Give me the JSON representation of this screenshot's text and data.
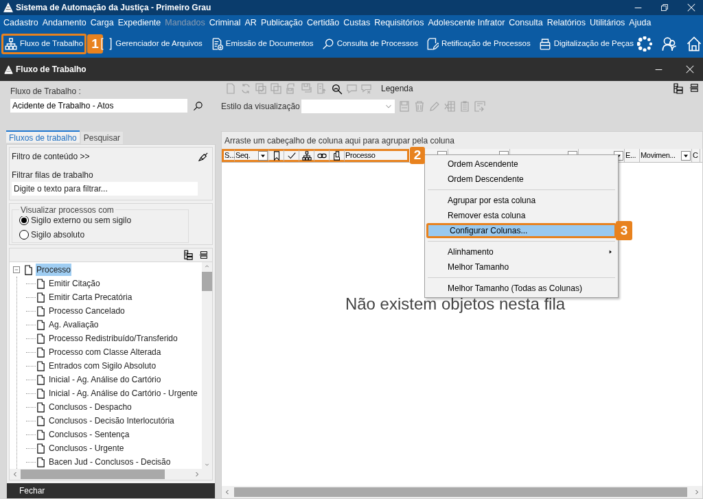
{
  "window": {
    "title": "Sistema de Automação da Justiça - Primeiro Grau"
  },
  "menu": [
    {
      "label": "Cadastro",
      "disabled": false
    },
    {
      "label": "Andamento",
      "disabled": false
    },
    {
      "label": "Carga",
      "disabled": false
    },
    {
      "label": "Expediente",
      "disabled": false
    },
    {
      "label": "Mandados",
      "disabled": true
    },
    {
      "label": "Criminal",
      "disabled": false
    },
    {
      "label": "AR",
      "disabled": false
    },
    {
      "label": "Publicação",
      "disabled": false
    },
    {
      "label": "Certidão",
      "disabled": false
    },
    {
      "label": "Custas",
      "disabled": false
    },
    {
      "label": "Requisitórios",
      "disabled": false
    },
    {
      "label": "Adolescente Infrator",
      "disabled": false
    },
    {
      "label": "Consulta",
      "disabled": false
    },
    {
      "label": "Relatórios",
      "disabled": false
    },
    {
      "label": "Utilitários",
      "disabled": false
    },
    {
      "label": "Ajuda",
      "disabled": false
    }
  ],
  "toolbar": [
    {
      "label": "Fluxo de Trabalho",
      "highlighted": true,
      "callout": "1"
    },
    {
      "label": "Gerenciador de Arquivos",
      "highlighted": false
    },
    {
      "label": "Emissão de Documentos",
      "highlighted": false
    },
    {
      "label": "Consulta de Processos",
      "highlighted": false
    },
    {
      "label": "Retificação de Processos",
      "highlighted": false
    },
    {
      "label": "Digitalização de Peças",
      "highlighted": false
    }
  ],
  "subwindow": {
    "title": "Fluxo de Trabalho"
  },
  "workflow_field": {
    "label": "Fluxo de Trabalho :",
    "value": "Acidente de Trabalho - Atos"
  },
  "tabs": [
    {
      "label": "Fluxos de trabalho",
      "selected": true
    },
    {
      "label": "Pesquisar",
      "selected": false
    }
  ],
  "filter": {
    "header": "Filtro de conteúdo >>",
    "label": "Filtrar filas de trabalho",
    "placeholder": "Digite o texto para filtrar..."
  },
  "visibility": {
    "title": "Visualizar processos com",
    "options": [
      {
        "label": "Sigilo externo ou sem sigilo",
        "selected": true
      },
      {
        "label": "Sigilo absoluto",
        "selected": false
      }
    ]
  },
  "tree": [
    {
      "label": "Processo",
      "selected": true,
      "expanded": true,
      "children": [
        {
          "label": "Emitir Citação",
          "selected": false
        },
        {
          "label": "Emitir Carta Precatória",
          "selected": false
        },
        {
          "label": "Processo Cancelado",
          "selected": false
        },
        {
          "label": "Ag. Avaliação",
          "selected": false
        },
        {
          "label": "Processo Redistribuído/Transferido",
          "selected": false
        },
        {
          "label": "Processo com Classe Alterada",
          "selected": false
        },
        {
          "label": "Entrados com Sigilo Absoluto",
          "selected": false
        },
        {
          "label": "Inicial - Ag. Análise do Cartório",
          "selected": false
        },
        {
          "label": "Inicial - Ag. Análise do Cartório - Urgente",
          "selected": false
        },
        {
          "label": "Conclusos - Despacho",
          "selected": false
        },
        {
          "label": "Conclusos - Decisão Interlocutória",
          "selected": false
        },
        {
          "label": "Conclusos - Sentença",
          "selected": false
        },
        {
          "label": "Conclusos - Urgente",
          "selected": false
        },
        {
          "label": "Bacen Jud - Conclusos - Decisão",
          "selected": false
        }
      ]
    }
  ],
  "close_button": "Fechar",
  "legend_label": "Legenda",
  "view_style": {
    "label": "Estilo da visualização"
  },
  "grid": {
    "group_hint": "Arraste um cabeçalho de coluna aqui para agrupar pela coluna",
    "callout": "2",
    "columns": [
      {
        "kind": "text",
        "label": "S...",
        "dropdown": false,
        "highlighted": true
      },
      {
        "kind": "text",
        "label": "Seq.",
        "dropdown": true,
        "highlighted": true
      },
      {
        "kind": "icon",
        "dropdown": false,
        "highlighted": true
      },
      {
        "kind": "icon",
        "dropdown": false,
        "highlighted": true
      },
      {
        "kind": "icon",
        "dropdown": false,
        "highlighted": true
      },
      {
        "kind": "icon",
        "dropdown": false,
        "highlighted": true
      },
      {
        "kind": "icon",
        "dropdown": false,
        "highlighted": true
      },
      {
        "kind": "text",
        "label": "Processo",
        "dropdown": false,
        "highlighted": true
      },
      {
        "kind": "blank",
        "dropdown": true,
        "highlighted": false
      },
      {
        "kind": "blank",
        "dropdown": true,
        "highlighted": false
      },
      {
        "kind": "blank",
        "dropdown": true,
        "highlighted": false
      },
      {
        "kind": "blank",
        "dropdown": true,
        "highlighted": false
      },
      {
        "kind": "text",
        "label": "E...",
        "dropdown": false,
        "highlighted": false
      },
      {
        "kind": "text",
        "label": "Movimen...",
        "dropdown": true,
        "highlighted": false
      },
      {
        "kind": "text",
        "label": "C",
        "dropdown": false,
        "highlighted": false
      }
    ],
    "empty_message": "Não existem objetos nesta fila"
  },
  "context_menu": [
    [
      {
        "label": "Ordem Ascendente",
        "selected": false,
        "submenu": false
      },
      {
        "label": "Ordem Descendente",
        "selected": false,
        "submenu": false
      }
    ],
    [
      {
        "label": "Agrupar por esta coluna",
        "selected": false,
        "submenu": false
      },
      {
        "label": "Remover esta coluna",
        "selected": false,
        "submenu": false
      },
      {
        "label": "Configurar Colunas...",
        "selected": true,
        "submenu": false,
        "callout": "3"
      }
    ],
    [
      {
        "label": "Alinhamento",
        "selected": false,
        "submenu": true
      },
      {
        "label": "Melhor Tamanho",
        "selected": false,
        "submenu": false
      }
    ],
    [
      {
        "label": "Melhor Tamanho (Todas as Colunas)",
        "selected": false,
        "submenu": false
      }
    ]
  ]
}
